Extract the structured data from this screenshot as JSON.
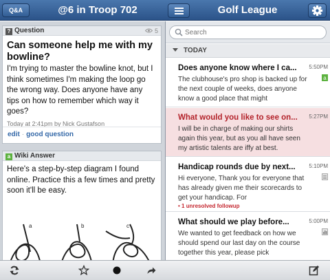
{
  "header": {
    "qa_badge": "Q&A",
    "left_title": "@6 in Troop 702",
    "right_title": "Golf League"
  },
  "question": {
    "label": "Question",
    "tag": "?",
    "views": "5",
    "title": "Can someone help me with my bowline?",
    "body": "I'm trying to master the bowline knot, but I think sometimes I'm making the loop go the wrong way. Does anyone have any tips on how to remember which way it goes?",
    "meta": "Today at 2:41pm by Nick Gustafson",
    "edit_label": "edit",
    "separator": "·",
    "good_question_label": "good question"
  },
  "answer": {
    "label": "Wiki Answer",
    "tag": "a",
    "body": "Here's a step-by-step diagram I found online. Practice this a few times and pretty soon it'll be easy.",
    "steps": [
      "a",
      "b",
      "c"
    ]
  },
  "search": {
    "placeholder": "Search"
  },
  "section": {
    "label": "TODAY"
  },
  "messages": [
    {
      "title": "Does anyone know where I ca...",
      "time": "5:50PM",
      "body": "The clubhouse's pro shop is backed up for the next couple of weeks, does anyone know a good place that might",
      "icon": "answer-icon"
    },
    {
      "title": "What would you like to see on...",
      "time": "5:27PM",
      "body": "I will be in charge of making our shirts again this year, but as you all have seen my artistic talents are iffy at best.",
      "icon": ""
    },
    {
      "title": "Handicap rounds due by next...",
      "time": "5:10PM",
      "body": "Hi everyone,  Thank you for everyone that has already given me their scorecards to get your handicap. For",
      "followup": "• 1 unresolved followup",
      "icon": "document-icon"
    },
    {
      "title": "What should we play before...",
      "time": "5:00PM",
      "body": "We wanted to get feedback on how we should spend our last day on the course together this year, please pick",
      "icon": "poll-icon"
    }
  ],
  "colors": {
    "header_blue": "#2b5389",
    "link_blue": "#3569a8",
    "selected_bg": "#f6dfe1",
    "alert_red": "#c4262e",
    "answer_green": "#5cb23f"
  }
}
